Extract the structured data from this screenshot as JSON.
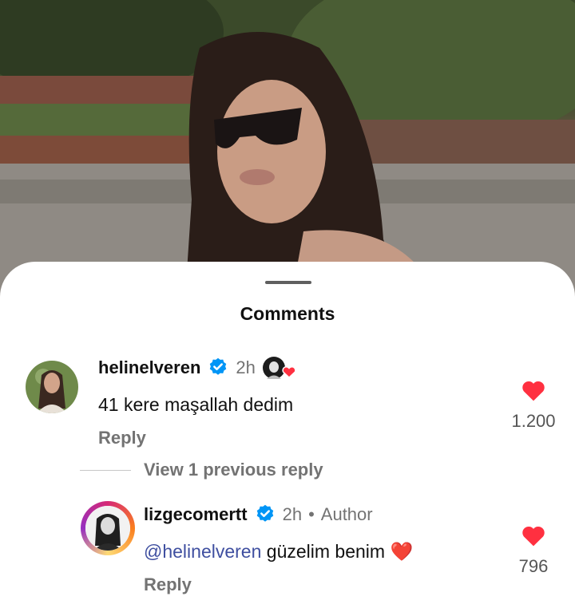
{
  "sheet": {
    "title": "Comments"
  },
  "comments": [
    {
      "username": "helinelveren",
      "verified": true,
      "time": "2h",
      "text": "41 kere maşallah dedim",
      "reply_label": "Reply",
      "likes": "1.200",
      "liked_by_author": true
    }
  ],
  "view_replies": {
    "label": "View 1 previous reply"
  },
  "replies": [
    {
      "username": "lizgecomertt",
      "verified": true,
      "time": "2h",
      "separator": "•",
      "badge": "Author",
      "mention": "@helinelveren",
      "text": " güzelim benim",
      "emoji": "❤️",
      "reply_label": "Reply",
      "likes": "796"
    }
  ],
  "colors": {
    "heart": "#ff3040",
    "verified": "#0095f6",
    "mention": "#3f4fa0",
    "muted": "#737373"
  }
}
